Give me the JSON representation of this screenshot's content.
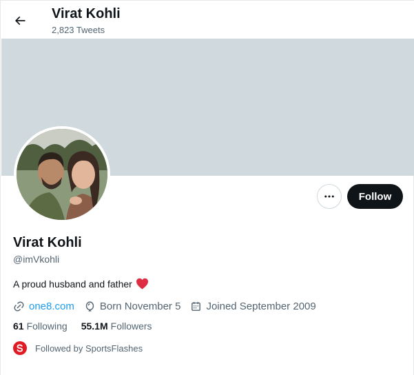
{
  "header": {
    "title": "Virat Kohli",
    "tweet_count": "2,823 Tweets"
  },
  "profile": {
    "display_name": "Virat Kohli",
    "handle": "@imVkohli",
    "bio": "A proud husband and father",
    "bio_emoji": "red-heart",
    "website": "one8.com",
    "born": "Born November 5",
    "joined": "Joined September 2009",
    "following_count": "61",
    "following_label": "Following",
    "followers_count": "55.1M",
    "followers_label": "Followers",
    "followed_by": "Followed by SportsFlashes"
  },
  "actions": {
    "follow_label": "Follow",
    "more_icon": "ellipsis-icon"
  },
  "icons": {
    "back": "arrow-left-icon",
    "link": "link-icon",
    "born": "balloon-icon",
    "joined": "calendar-icon"
  },
  "colors": {
    "banner": "#cfd9de",
    "link": "#1d9bf0",
    "follow_button": "#0f1419",
    "secondary_text": "#536471",
    "heart": "#e0245e"
  }
}
